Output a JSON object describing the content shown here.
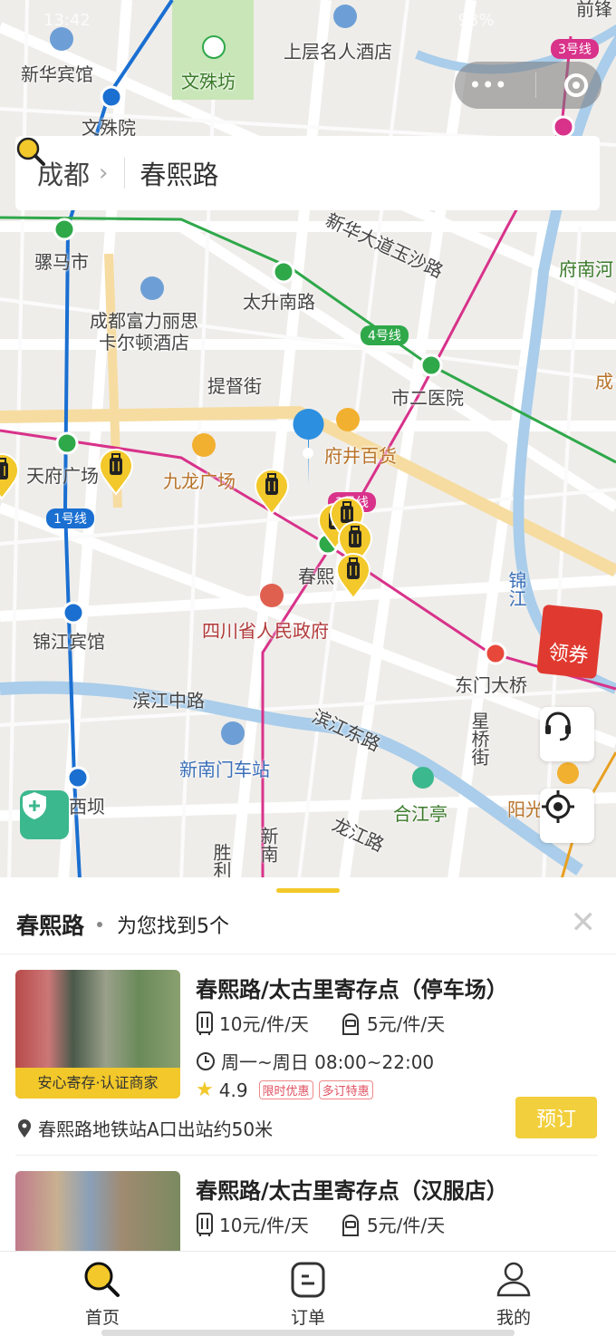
{
  "status_bar": {
    "time": "13:42",
    "battery": "93%"
  },
  "capsule": {
    "more_icon": "more-dots-icon",
    "close_icon": "target-circle-icon"
  },
  "search": {
    "city": "成都",
    "query": "春熙路"
  },
  "map": {
    "labels": [
      "新华宾馆",
      "文殊坊",
      "上层名人酒店",
      "文殊院",
      "骡马市",
      "太升南路",
      "成都富力丽思\n卡尔顿酒店",
      "府南河",
      "提督街",
      "市二医院",
      "天府广场",
      "九龙广场",
      "府井百货",
      "春熙",
      "四川省人民政府",
      "锦江宾馆",
      "东门大桥",
      "滨江中路",
      "滨江东路",
      "新南门车站",
      "合江亭",
      "西坝",
      "龙江路",
      "新华大道玉沙路",
      "锦江",
      "阳光",
      "胜利",
      "新南",
      "前锋",
      "成",
      "星桥街"
    ],
    "line_badges": [
      "3号线",
      "4号线",
      "1号线",
      "3号线"
    ],
    "colors": {
      "line1": "#1a6fd1",
      "line3": "#d8328a",
      "line4": "#2fa84a",
      "line2": "#e8483a",
      "river": "#a9cdea",
      "accent": "#f2c82a"
    }
  },
  "coupon": {
    "label": "领券"
  },
  "sheet": {
    "title": "春熙路",
    "found": "为您找到5个",
    "results": [
      {
        "name": "春熙路/太古里寄存点（停车场）",
        "badge": "安心寄存·认证商家",
        "luggage_price": "10元/件/天",
        "bag_price": "5元/件/天",
        "hours": "周一~周日 08:00~22:00",
        "rating": "4.9",
        "tags": [
          "限时优惠",
          "多订特惠"
        ],
        "address": "春熙路地铁站A口出站约50米",
        "book": "预订"
      },
      {
        "name": "春熙路/太古里寄存点（汉服店）",
        "luggage_price": "10元/件/天",
        "bag_price": "5元/件/天"
      }
    ]
  },
  "tabbar": [
    {
      "label": "首页",
      "icon": "search-icon",
      "active": true
    },
    {
      "label": "订单",
      "icon": "order-icon"
    },
    {
      "label": "我的",
      "icon": "user-icon"
    }
  ]
}
